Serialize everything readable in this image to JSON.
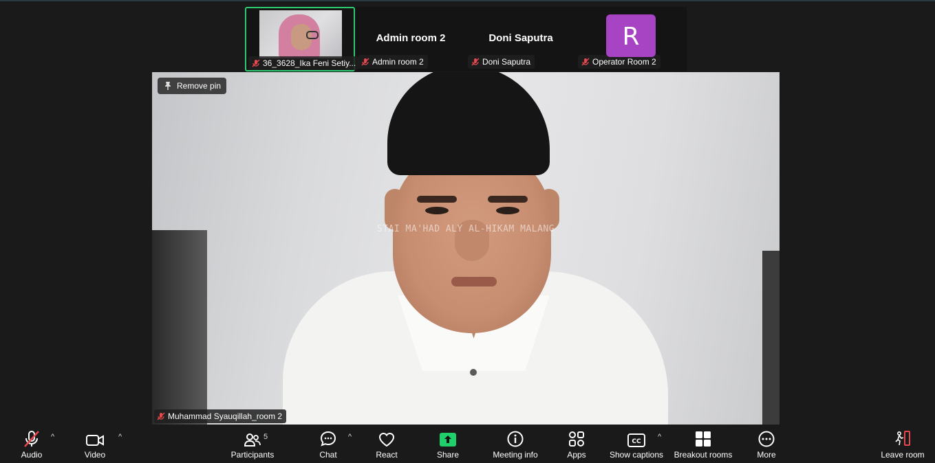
{
  "gallery": {
    "tiles": [
      {
        "label": "36_3628_Ika Feni Setiy...",
        "active": true
      },
      {
        "display_name": "Admin room 2",
        "label": "Admin room 2"
      },
      {
        "display_name": "Doni Saputra",
        "label": "Doni Saputra"
      },
      {
        "avatar_letter": "R",
        "avatar_color": "#a644c4",
        "label": "Operator Room 2"
      }
    ]
  },
  "main": {
    "remove_pin_label": "Remove pin",
    "watermark": "STAI MA'HAD ALY AL-HIKAM MALANG",
    "participant_name": "Muhammad Syauqillah_room 2"
  },
  "toolbar": {
    "audio": "Audio",
    "video": "Video",
    "participants": "Participants",
    "participants_count": "5",
    "chat": "Chat",
    "react": "React",
    "share": "Share",
    "meeting_info": "Meeting info",
    "apps": "Apps",
    "show_captions": "Show captions",
    "breakout_rooms": "Breakout rooms",
    "more": "More",
    "leave_room": "Leave room"
  },
  "colors": {
    "active_tile_border": "#2ecc71",
    "share_green": "#1fcf6c",
    "muted_red": "#e5484d",
    "leave_red": "#e5484d"
  }
}
